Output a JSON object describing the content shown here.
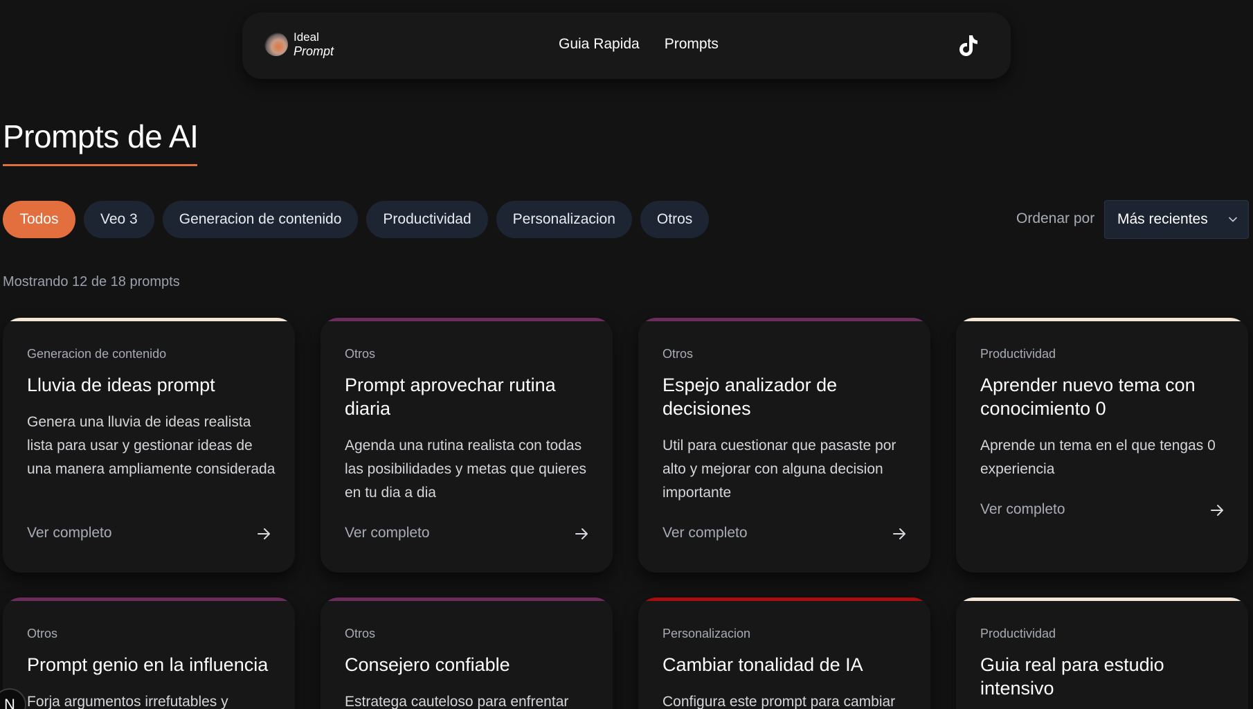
{
  "nav": {
    "logo_line1": "Ideal",
    "logo_line2": "Prompt",
    "links": [
      "Guia Rapida",
      "Prompts"
    ],
    "social_icon": "tiktok-icon"
  },
  "page": {
    "title": "Prompts de AI",
    "accent_color": "#e36f3f"
  },
  "filters": {
    "chips": [
      "Todos",
      "Veo 3",
      "Generacion de contenido",
      "Productividad",
      "Personalizacion",
      "Otros"
    ],
    "active": "Todos"
  },
  "sort": {
    "label": "Ordenar por",
    "selected": "Más recientes"
  },
  "results": {
    "count_text": "Mostrando 12 de 18 prompts"
  },
  "cards": [
    {
      "category": "Generacion de contenido",
      "title": "Lluvia de ideas prompt",
      "description": "Genera una lluvia de ideas realista lista para usar y gestionar ideas de una manera ampliamente considerada",
      "link": "Ver completo",
      "accent": "#f3e6d6"
    },
    {
      "category": "Otros",
      "title": "Prompt aprovechar rutina diaria",
      "description": "Agenda una rutina realista con todas las posibilidades y metas que quieres en tu dia a dia",
      "link": "Ver completo",
      "accent": "#6b2d5c"
    },
    {
      "category": "Otros",
      "title": "Espejo analizador de decisiones",
      "description": "Util para cuestionar que pasaste por alto y mejorar con alguna decision importante",
      "link": "Ver completo",
      "accent": "#6b2d5c"
    },
    {
      "category": "Productividad",
      "title": "Aprender nuevo tema con conocimiento 0",
      "description": "Aprende un tema en el que tengas 0 experiencia",
      "link": "Ver completo",
      "accent": "#f3e6d6"
    },
    {
      "category": "Otros",
      "title": "Prompt genio en la influencia",
      "description": "Forja argumentos irrefutables y",
      "accent": "#6b2d5c"
    },
    {
      "category": "Otros",
      "title": "Consejero confiable",
      "description": "Estratega cauteloso para enfrentar",
      "accent": "#6b2d5c"
    },
    {
      "category": "Personalizacion",
      "title": "Cambiar tonalidad de IA",
      "description": "Configura este prompt para cambiar",
      "accent": "#a80d0d"
    },
    {
      "category": "Productividad",
      "title": "Guia real para estudio intensivo",
      "description": "",
      "accent": "#f3e6d6"
    }
  ],
  "floating_badge": "N"
}
